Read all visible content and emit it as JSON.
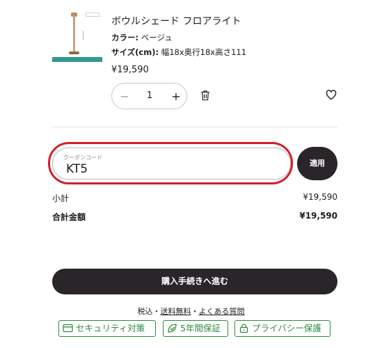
{
  "product": {
    "name": "ボウルシェード フロアライト",
    "color_label": "カラー:",
    "color_value": "ベージュ",
    "size_label": "サイズ(cm):",
    "size_value": "幅18x奥行18x高さ111",
    "price": "¥19,590",
    "quantity": "1"
  },
  "coupon": {
    "label": "クーポンコード",
    "value": "KT5",
    "apply_label": "適用"
  },
  "summary": {
    "subtotal_label": "小計",
    "subtotal_value": "¥19,590",
    "total_label": "合計金額",
    "total_value": "¥19,590"
  },
  "checkout_label": "購入手続きへ進む",
  "footer_links": {
    "tax": "税込",
    "sep1": "・",
    "shipping": "送料無料",
    "sep2": "・",
    "faq": "よくある質問"
  },
  "badges": {
    "security": "セキュリティ対策",
    "warranty": "5年間保証",
    "privacy": "プライバシー保護"
  },
  "icons": {
    "minus": "minus-icon",
    "plus": "plus-icon",
    "trash": "trash-icon",
    "heart": "heart-icon",
    "card": "credit-card-icon",
    "leaf": "leaf-check-icon",
    "lock": "lock-icon"
  },
  "colors": {
    "primary_dark": "#2a2529",
    "highlight_red": "#d21e28",
    "badge_green": "#2e8b3e"
  }
}
